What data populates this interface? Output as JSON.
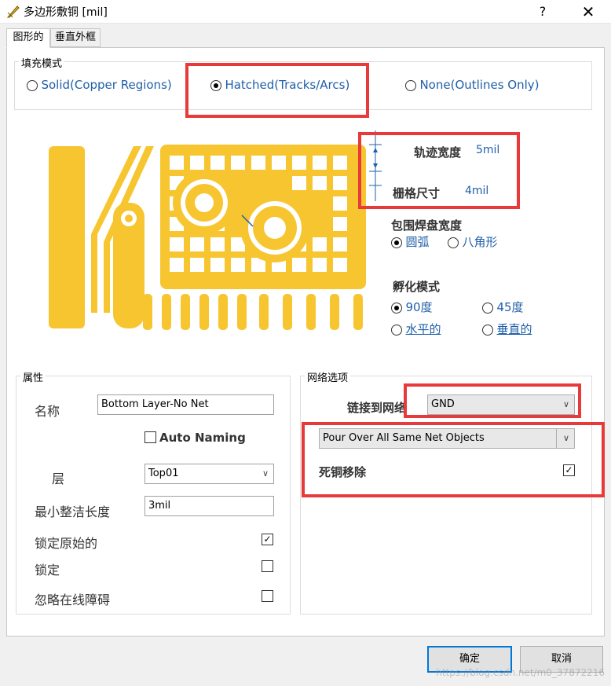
{
  "window": {
    "title": "多边形敷铜 [mil]",
    "help": "?",
    "close": "✕"
  },
  "tabs": [
    "图形的",
    "垂直外框"
  ],
  "fill_mode": {
    "group_label": "填充模式",
    "options": [
      "Solid(Copper Regions)",
      "Hatched(Tracks/Arcs)",
      "None(Outlines Only)"
    ],
    "selected": "Hatched(Tracks/Arcs)"
  },
  "hatch": {
    "track_width_label": "轨迹宽度",
    "track_width_value": "5mil",
    "grid_size_label": "栅格尺寸",
    "grid_size_value": "4mil"
  },
  "pad_surround": {
    "label": "包围焊盘宽度",
    "options": [
      "圆弧",
      "八角形"
    ],
    "selected": "圆弧"
  },
  "hatch_mode": {
    "label": "孵化模式",
    "options": [
      "90度",
      "45度",
      "水平的",
      "垂直的"
    ],
    "selected": "90度"
  },
  "properties": {
    "group_label": "属性",
    "name_label": "名称",
    "name_value": "Bottom Layer-No Net",
    "auto_naming_label": "Auto Naming",
    "auto_naming": false,
    "layer_label": "层",
    "layer_value": "Top01",
    "min_length_label": "最小整洁长度",
    "min_length_value": "3mil",
    "lock_primitives_label": "锁定原始的",
    "lock_primitives": true,
    "locked_label": "锁定",
    "locked": false,
    "ignore_drc_label": "忽略在线障碍",
    "ignore_drc": false
  },
  "net_options": {
    "group_label": "网络选项",
    "connect_label": "链接到网络",
    "connect_value": "GND",
    "pour_mode_value": "Pour Over All Same Net Objects",
    "remove_dead_label": "死铜移除",
    "remove_dead": true
  },
  "buttons": {
    "ok": "确定",
    "cancel": "取消"
  },
  "watermark": "https://blog.csdn.net/m0_37872216",
  "colors": {
    "copper": "#f7c52f",
    "annotation_red": "#e83a3a",
    "link_blue": "#1f5fa8"
  }
}
